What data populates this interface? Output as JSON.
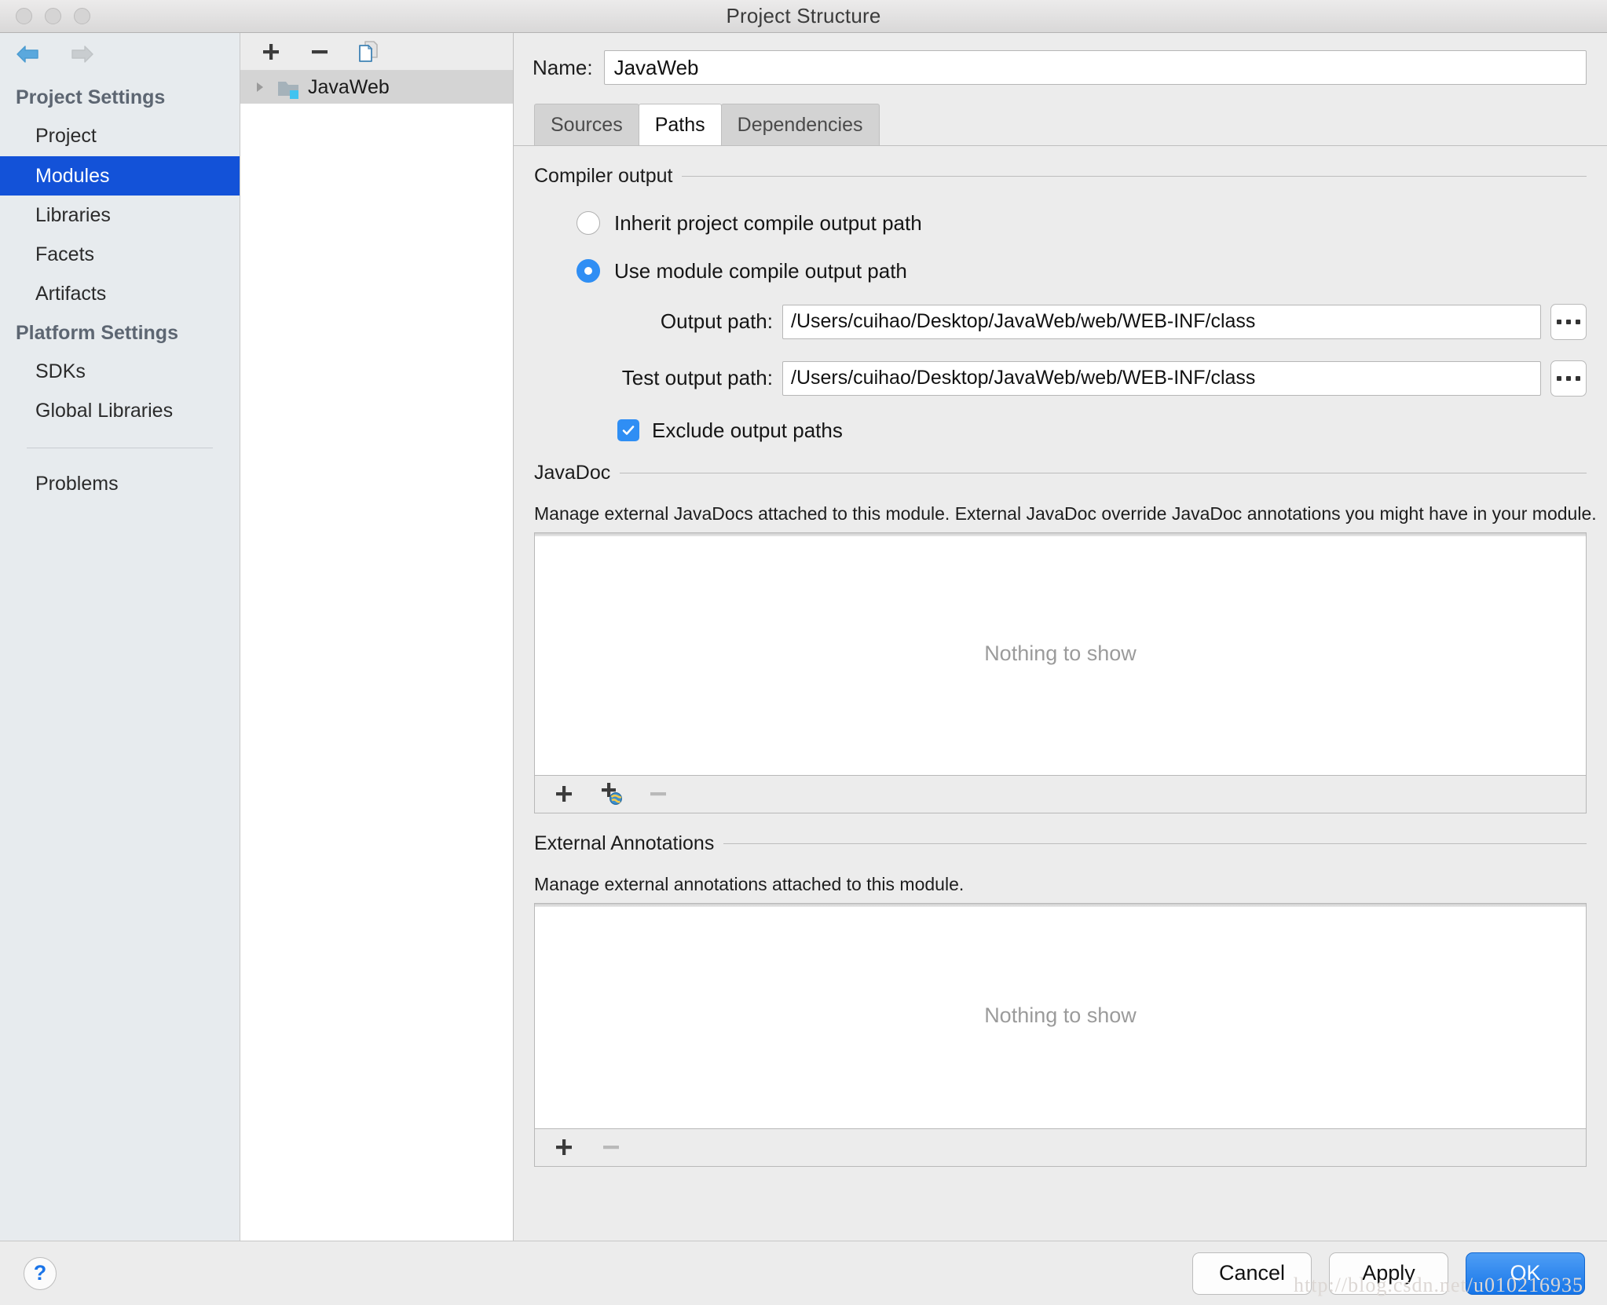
{
  "window": {
    "title": "Project Structure",
    "traffic_lights": [
      "close",
      "minimize",
      "zoom"
    ]
  },
  "nav": {
    "back_icon": "back-arrow-icon",
    "forward_icon": "forward-arrow-icon",
    "groups": [
      {
        "label": "Project Settings",
        "items": [
          {
            "label": "Project",
            "selected": false
          },
          {
            "label": "Modules",
            "selected": true
          },
          {
            "label": "Libraries",
            "selected": false
          },
          {
            "label": "Facets",
            "selected": false
          },
          {
            "label": "Artifacts",
            "selected": false
          }
        ]
      },
      {
        "label": "Platform Settings",
        "items": [
          {
            "label": "SDKs",
            "selected": false
          },
          {
            "label": "Global Libraries",
            "selected": false
          }
        ]
      }
    ],
    "extra": [
      {
        "label": "Problems"
      }
    ],
    "selected_color": "#1352d8"
  },
  "tree": {
    "toolbar": [
      {
        "name": "add-module-button",
        "icon": "plus-icon"
      },
      {
        "name": "remove-module-button",
        "icon": "minus-icon"
      },
      {
        "name": "copy-module-button",
        "icon": "copy-icon"
      }
    ],
    "rows": [
      {
        "label": "JavaWeb",
        "expander": "triangle-right-icon",
        "icon": "module-folder-icon",
        "selected": true
      }
    ]
  },
  "module": {
    "name_label": "Name:",
    "name_value": "JavaWeb",
    "tabs": [
      {
        "label": "Sources",
        "active": false
      },
      {
        "label": "Paths",
        "active": true
      },
      {
        "label": "Dependencies",
        "active": false
      }
    ]
  },
  "compiler_output": {
    "group_title": "Compiler output",
    "options": [
      {
        "label": "Inherit project compile output path",
        "selected": false
      },
      {
        "label": "Use module compile output path",
        "selected": true
      }
    ],
    "output_path_label": "Output path:",
    "output_path_value": "/Users/cuihao/Desktop/JavaWeb/web/WEB-INF/class",
    "test_output_path_label": "Test output path:",
    "test_output_path_value": "/Users/cuihao/Desktop/JavaWeb/web/WEB-INF/class",
    "browse_icon": "ellipsis-icon",
    "exclude_label": "Exclude output paths",
    "exclude_checked": true,
    "accent_color": "#2f8ef4"
  },
  "javadoc": {
    "group_title": "JavaDoc",
    "description": "Manage external JavaDocs attached to this module. External JavaDoc override JavaDoc annotations you might have in your module.",
    "empty_text": "Nothing to show",
    "toolbar": [
      {
        "name": "add-javadoc-path-button",
        "icon": "plus-icon",
        "enabled": true
      },
      {
        "name": "add-javadoc-url-button",
        "icon": "plus-globe-icon",
        "enabled": true
      },
      {
        "name": "remove-javadoc-button",
        "icon": "minus-icon",
        "enabled": false
      }
    ]
  },
  "annotations": {
    "group_title": "External Annotations",
    "description": "Manage external annotations attached to this module.",
    "empty_text": "Nothing to show",
    "toolbar": [
      {
        "name": "add-annotation-button",
        "icon": "plus-icon",
        "enabled": true
      },
      {
        "name": "remove-annotation-button",
        "icon": "minus-icon",
        "enabled": false
      }
    ]
  },
  "footer": {
    "help_label": "?",
    "cancel_label": "Cancel",
    "apply_label": "Apply",
    "ok_label": "OK",
    "ok_color": "#1675e8",
    "watermark": "http://blog.csdn.net/u010216935"
  }
}
